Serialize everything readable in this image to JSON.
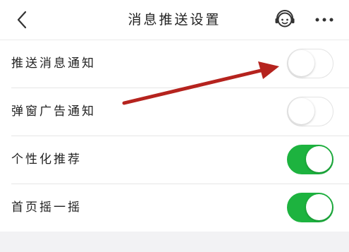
{
  "header": {
    "title": "消息推送设置",
    "back_icon": "chevron-left-icon",
    "support_icon": "customer-service-icon",
    "more_icon": "more-dots-icon"
  },
  "settings": [
    {
      "label": "推送消息通知",
      "enabled": false
    },
    {
      "label": "弹窗广告通知",
      "enabled": false
    },
    {
      "label": "个性化推荐",
      "enabled": true
    },
    {
      "label": "首页摇一摇",
      "enabled": true
    }
  ],
  "colors": {
    "toggle_on": "#1db33f",
    "annotation_arrow": "#b5231e",
    "background": "#f2f2f4"
  }
}
